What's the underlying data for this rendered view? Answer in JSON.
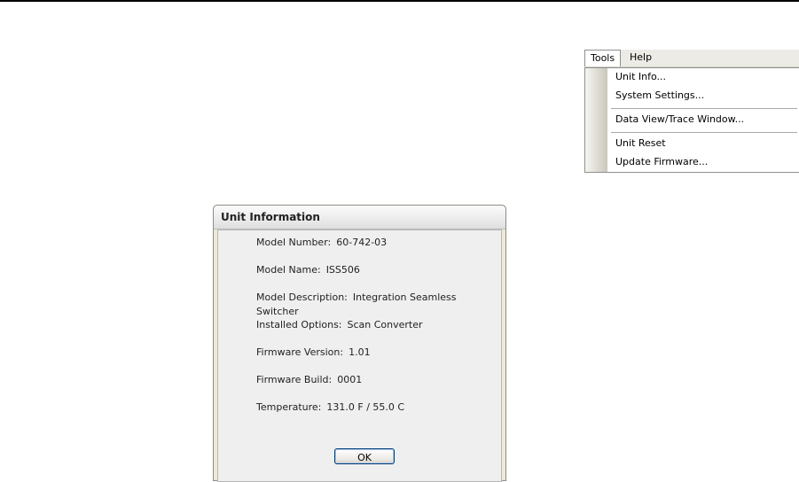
{
  "menu": {
    "titles": {
      "tools": "Tools",
      "help": "Help"
    },
    "items": [
      {
        "label": "Unit Info..."
      },
      {
        "label": "System Settings..."
      },
      {
        "label": "Data View/Trace Window..."
      },
      {
        "label": "Unit Reset"
      },
      {
        "label": "Update Firmware..."
      }
    ]
  },
  "dialog": {
    "title": "Unit Information",
    "fields": [
      {
        "label": "Model Number:",
        "value": "60-742-03"
      },
      {
        "label": "Model Name:",
        "value": "ISS506"
      },
      {
        "label": "Model Description:",
        "value": "Integration Seamless Switcher"
      },
      {
        "label": "Installed Options:",
        "value": "Scan Converter"
      },
      {
        "label": "Firmware Version:",
        "value": "1.01"
      },
      {
        "label": "Firmware Build:",
        "value": "0001"
      },
      {
        "label": "Temperature:",
        "value": "131.0 F / 55.0 C"
      }
    ],
    "ok_label": "OK"
  }
}
